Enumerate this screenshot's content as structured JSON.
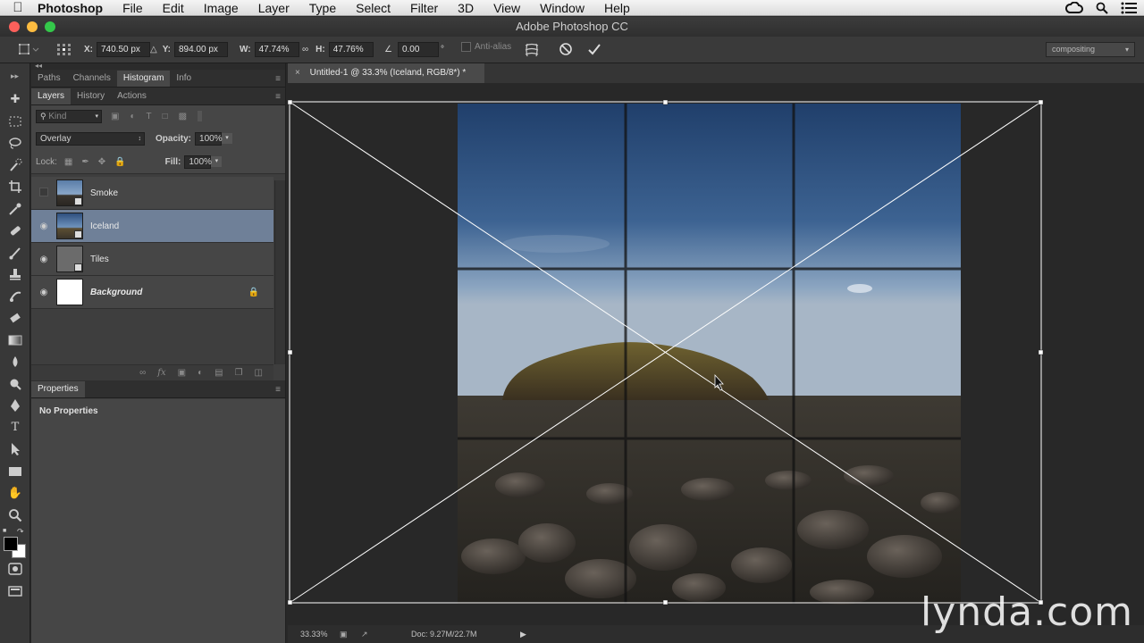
{
  "menubar": {
    "app_name": "Photoshop",
    "items": [
      "File",
      "Edit",
      "Image",
      "Layer",
      "Type",
      "Select",
      "Filter",
      "3D",
      "View",
      "Window",
      "Help"
    ],
    "right_icons": [
      "creative-cloud-icon",
      "spotlight-search-icon",
      "notification-list-icon"
    ]
  },
  "window": {
    "title": "Adobe Photoshop CC"
  },
  "options": {
    "x_label": "X:",
    "x_value": "740.50 px",
    "y_label": "Y:",
    "y_value": "894.00 px",
    "w_label": "W:",
    "w_value": "47.74%",
    "h_label": "H:",
    "h_value": "47.76%",
    "angle_value": "0.00",
    "angle_unit": "°",
    "antialias_label": "Anti-alias",
    "workspace": "compositing"
  },
  "panel_group_top": {
    "tabs": [
      "Paths",
      "Channels",
      "Histogram",
      "Info"
    ],
    "active": "Histogram"
  },
  "layers_panel": {
    "tabs": [
      "Layers",
      "History",
      "Actions"
    ],
    "kind_label": "Kind",
    "blend_mode": "Overlay",
    "opacity_label": "Opacity:",
    "opacity_value": "100%",
    "lock_label": "Lock:",
    "fill_label": "Fill:",
    "fill_value": "100%",
    "layers": [
      {
        "name": "Smoke",
        "visible": false
      },
      {
        "name": "Iceland",
        "visible": true,
        "selected": true
      },
      {
        "name": "Tiles",
        "visible": true
      },
      {
        "name": "Background",
        "visible": true,
        "locked": true
      }
    ]
  },
  "properties_panel": {
    "title": "Properties",
    "message": "No Properties"
  },
  "document": {
    "tab_title": "Untitled-1 @ 33.3% (Iceland, RGB/8*) *",
    "zoom": "33.33%",
    "doc_size": "Doc: 9.27M/22.7M"
  },
  "watermark": "lynda.com",
  "colors": {
    "accent_selected_layer": "#6f8098",
    "panel_bg": "#3e3e3e",
    "canvas_bg": "#282828"
  }
}
